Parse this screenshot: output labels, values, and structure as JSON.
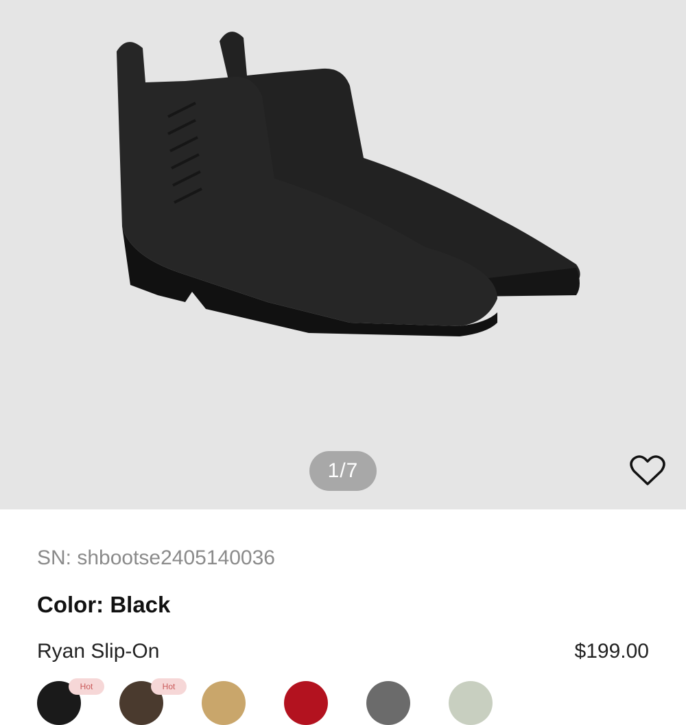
{
  "gallery": {
    "counter": "1/7",
    "favorite_icon": "heart-outline-icon",
    "background_color": "#e5e5e5"
  },
  "product": {
    "sn": "SN: shbootse2405140036",
    "color_label": "Color:",
    "color_value": "Black",
    "name": "Ryan Slip-On",
    "price": "$199.00"
  },
  "swatches": [
    {
      "name": "Black",
      "color": "#1a1a1a",
      "tag": "Hot"
    },
    {
      "name": "Brown",
      "color": "#4a3a2e",
      "tag": "Hot"
    },
    {
      "name": "Tan",
      "color": "#c9a66b"
    },
    {
      "name": "Red",
      "color": "#b3121f"
    },
    {
      "name": "Grey",
      "color": "#6b6b6b"
    },
    {
      "name": "Sage",
      "color": "#c8cfc0"
    }
  ]
}
